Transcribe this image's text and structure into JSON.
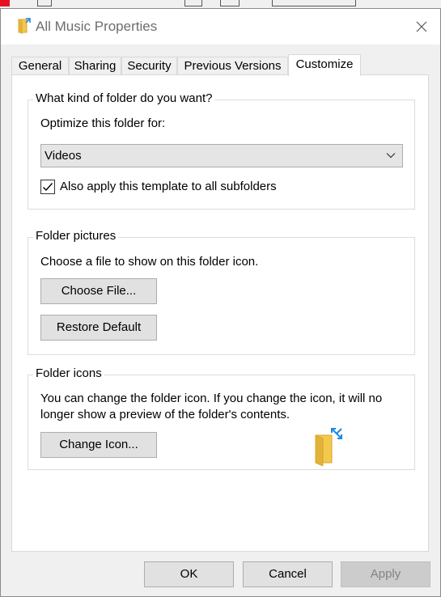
{
  "window": {
    "title": "All Music Properties"
  },
  "tabs": [
    {
      "label": "General"
    },
    {
      "label": "Sharing"
    },
    {
      "label": "Security"
    },
    {
      "label": "Previous Versions"
    },
    {
      "label": "Customize"
    }
  ],
  "folder_type": {
    "group_title": "What kind of folder do you want?",
    "optimize_label": "Optimize this folder for:",
    "selected": "Videos",
    "apply_subfolders_label": "Also apply this template to all subfolders",
    "apply_subfolders_checked": true
  },
  "folder_pictures": {
    "group_title": "Folder pictures",
    "description": "Choose a file to show on this folder icon.",
    "choose_file_label": "Choose File...",
    "restore_default_label": "Restore Default"
  },
  "folder_icons": {
    "group_title": "Folder icons",
    "description_line1": "You can change the folder icon. If you change the icon, it will no",
    "description_line2": "longer show a preview of the folder's contents.",
    "change_icon_label": "Change Icon..."
  },
  "footer": {
    "ok_label": "OK",
    "cancel_label": "Cancel",
    "apply_label": "Apply",
    "apply_enabled": false
  },
  "colors": {
    "folder_yellow": "#f3c94d",
    "folder_dark": "#d9a528",
    "shortcut_blue": "#1e88e5"
  }
}
